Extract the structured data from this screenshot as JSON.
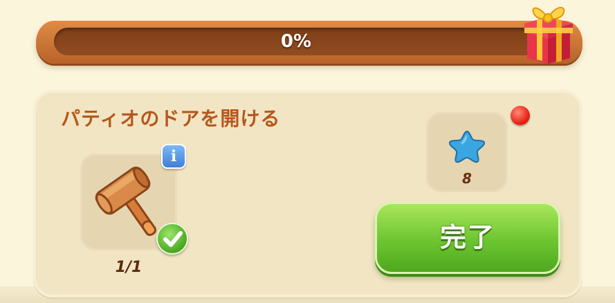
{
  "progress": {
    "label": "0%",
    "value": 0
  },
  "quest": {
    "title": "パティオのドアを開ける",
    "item": {
      "icon": "hammer-icon",
      "count": "1/1"
    },
    "info_label": "i",
    "reward": {
      "icon": "blue-star-icon",
      "amount": "8"
    },
    "complete_label": "完了"
  },
  "colors": {
    "progress_frame": "#c97136",
    "progress_track": "#884520",
    "title": "#b4581c",
    "button_green": "#6cc530",
    "notification_red": "#e51e0e",
    "star_blue": "#3aa6e0"
  }
}
